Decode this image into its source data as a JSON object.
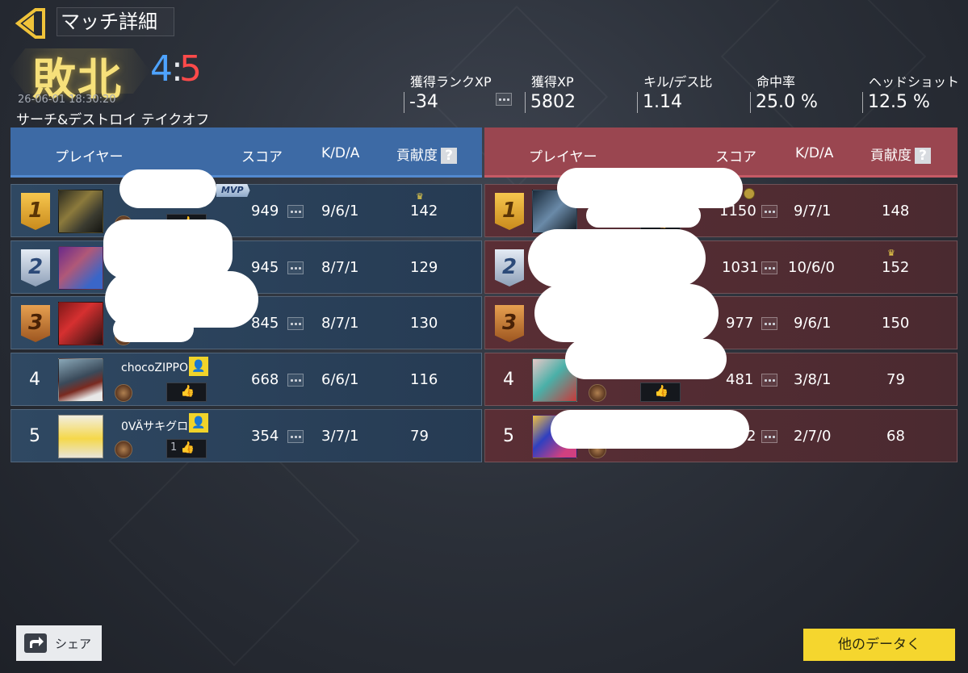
{
  "header": {
    "title": "マッチ詳細",
    "result": "敗北",
    "score_blue": "4",
    "score_separator": ":",
    "score_red": "5",
    "datetime": "26-06-01 18:30:20",
    "mode": "サーチ&デストロイ  テイクオフ"
  },
  "stats": [
    {
      "label": "獲得ランクXP",
      "value": "-34"
    },
    {
      "label": "獲得XP",
      "value": "5802"
    },
    {
      "label": "キル/デス比",
      "value": "1.14"
    },
    {
      "label": "命中率",
      "value": "25.0 %"
    },
    {
      "label": "ヘッドショット",
      "value": "12.5 %"
    }
  ],
  "columns": {
    "player": "プレイヤー",
    "score": "スコア",
    "kda": "K/D/A",
    "contribution": "貢献度",
    "help": "?"
  },
  "blue_team": {
    "color": "#3d6aa5",
    "rows": [
      {
        "rank": "1",
        "name": "",
        "score": "949",
        "kda": "9/6/1",
        "contribution": "142",
        "mvp": "MVP"
      },
      {
        "rank": "2",
        "name": "",
        "score": "945",
        "kda": "8/7/1",
        "contribution": "129"
      },
      {
        "rank": "3",
        "name": "",
        "score": "845",
        "kda": "8/7/1",
        "contribution": "130"
      },
      {
        "rank": "4",
        "name": "chocoZIPPO",
        "score": "668",
        "kda": "6/6/1",
        "contribution": "116"
      },
      {
        "rank": "5",
        "name": "0VÄサキグロ",
        "score": "354",
        "kda": "3/7/1",
        "contribution": "79",
        "likes": "1"
      }
    ]
  },
  "red_team": {
    "color": "#9a4650",
    "rows": [
      {
        "rank": "1",
        "score": "1150",
        "kda": "9/7/1",
        "contribution": "148"
      },
      {
        "rank": "2",
        "score": "1031",
        "kda": "10/6/0",
        "contribution": "152"
      },
      {
        "rank": "3",
        "score": "977",
        "kda": "9/6/1",
        "contribution": "150"
      },
      {
        "rank": "4",
        "score": "481",
        "kda": "3/8/1",
        "contribution": "79"
      },
      {
        "rank": "5",
        "score": "2",
        "kda": "2/7/0",
        "contribution": "68"
      }
    ]
  },
  "buttons": {
    "share": "シェア",
    "more_data": "他のデータく"
  },
  "icons": {
    "back": "back-arrow-icon",
    "share": "share-icon",
    "like": "thumbs-up-icon",
    "add_friend": "add-friend-icon",
    "crown": "crown-icon"
  }
}
